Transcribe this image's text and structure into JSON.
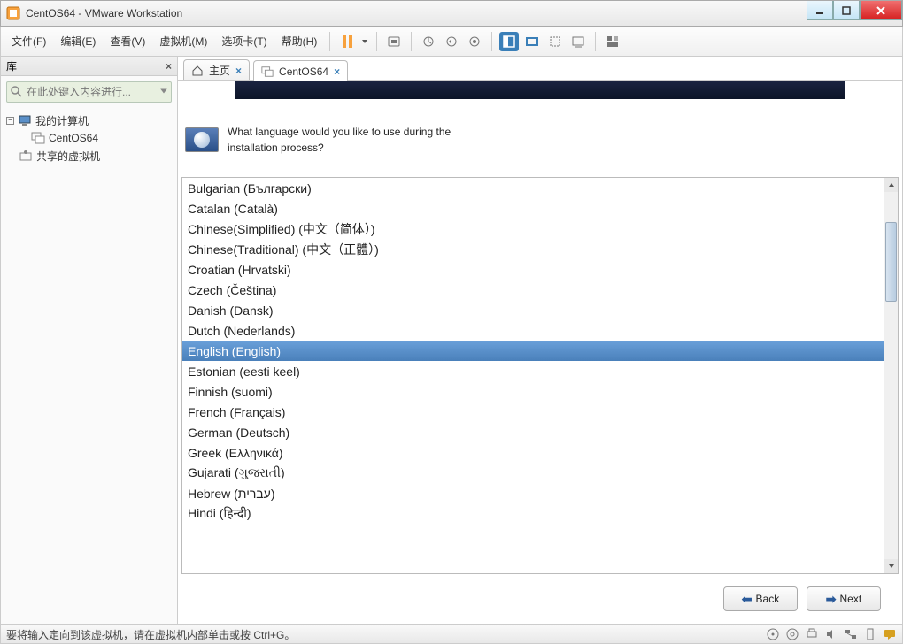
{
  "window": {
    "title": "CentOS64 - VMware Workstation"
  },
  "menu": {
    "file": "文件(F)",
    "edit": "编辑(E)",
    "view": "查看(V)",
    "vm": "虚拟机(M)",
    "tabs": "选项卡(T)",
    "help": "帮助(H)"
  },
  "sidebar": {
    "header": "库",
    "search_placeholder": "在此处键入内容进行...",
    "node_my_computer": "我的计算机",
    "node_centos": "CentOS64",
    "node_shared": "共享的虚拟机"
  },
  "tabs": {
    "home": "主页",
    "vm": "CentOS64"
  },
  "installer": {
    "question_line1": "What language would you like to use during the",
    "question_line2": "installation process?",
    "languages": [
      "Bulgarian (Български)",
      "Catalan (Català)",
      "Chinese(Simplified) (中文（简体）)",
      "Chinese(Traditional) (中文（正體）)",
      "Croatian (Hrvatski)",
      "Czech (Čeština)",
      "Danish (Dansk)",
      "Dutch (Nederlands)",
      "English (English)",
      "Estonian (eesti keel)",
      "Finnish (suomi)",
      "French (Français)",
      "German (Deutsch)",
      "Greek (Ελληνικά)",
      "Gujarati (ગુજરાતી)",
      "Hebrew (עברית)",
      "Hindi (हिन्दी)"
    ],
    "selected_index": 8,
    "back": "Back",
    "next": "Next"
  },
  "status": {
    "text": "要将输入定向到该虚拟机，请在虚拟机内部单击或按 Ctrl+G。"
  }
}
